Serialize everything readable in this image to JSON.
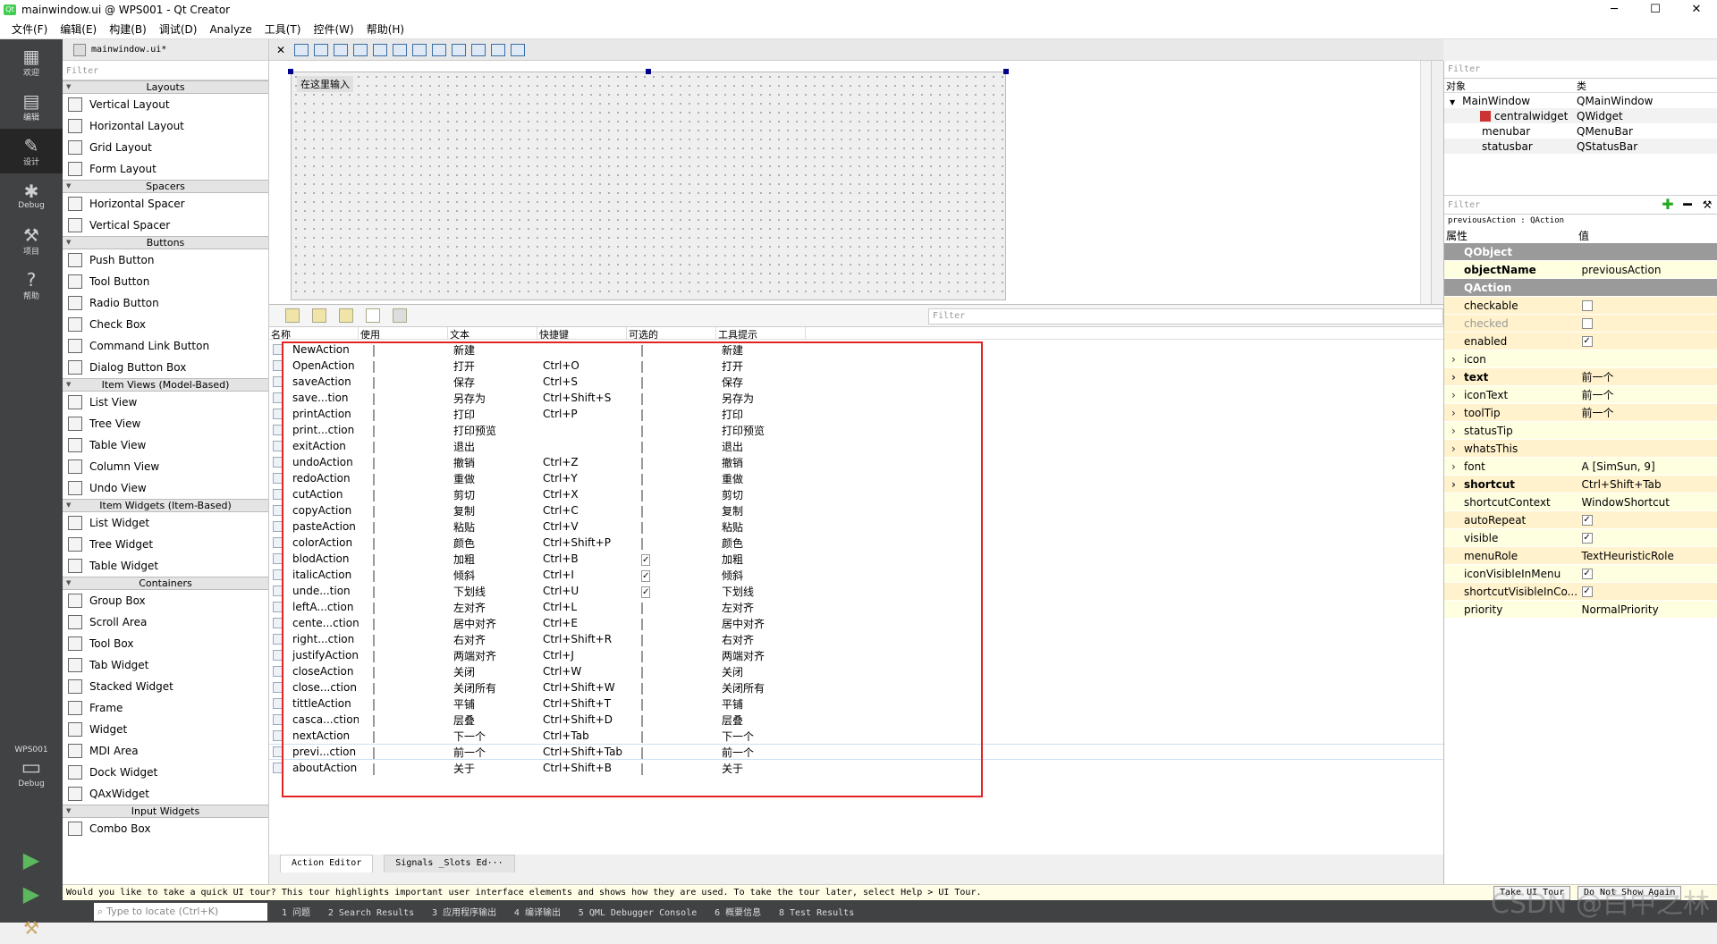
{
  "window": {
    "title": "mainwindow.ui @ WPS001 - Qt Creator",
    "controls": [
      "─",
      "☐",
      "✕"
    ]
  },
  "menus": [
    "文件(F)",
    "编辑(E)",
    "构建(B)",
    "调试(D)",
    "Analyze",
    "工具(T)",
    "控件(W)",
    "帮助(H)"
  ],
  "modes": [
    {
      "label": "欢迎",
      "icon": "grid-icon",
      "glyph": "▦"
    },
    {
      "label": "编辑",
      "icon": "edit-icon",
      "glyph": "▤"
    },
    {
      "label": "设计",
      "icon": "design-icon",
      "glyph": "✎"
    },
    {
      "label": "Debug",
      "icon": "bug-icon",
      "glyph": "✱"
    },
    {
      "label": "项目",
      "icon": "wrench-icon",
      "glyph": "⚒"
    },
    {
      "label": "帮助",
      "icon": "help-icon",
      "glyph": "?"
    }
  ],
  "kit": {
    "name": "WPS001",
    "mode": "Debug"
  },
  "editor": {
    "file_tab": "mainwindow.ui*",
    "form_menu_placeholder": "在这里输入"
  },
  "widget_box": {
    "filter_placeholder": "Filter",
    "sections": [
      {
        "title": "Layouts",
        "items": [
          "Vertical Layout",
          "Horizontal Layout",
          "Grid Layout",
          "Form Layout"
        ]
      },
      {
        "title": "Spacers",
        "items": [
          "Horizontal Spacer",
          "Vertical Spacer"
        ]
      },
      {
        "title": "Buttons",
        "items": [
          "Push Button",
          "Tool Button",
          "Radio Button",
          "Check Box",
          "Command Link Button",
          "Dialog Button Box"
        ]
      },
      {
        "title": "Item Views (Model-Based)",
        "items": [
          "List View",
          "Tree View",
          "Table View",
          "Column View",
          "Undo View"
        ]
      },
      {
        "title": "Item Widgets (Item-Based)",
        "items": [
          "List Widget",
          "Tree Widget",
          "Table Widget"
        ]
      },
      {
        "title": "Containers",
        "items": [
          "Group Box",
          "Scroll Area",
          "Tool Box",
          "Tab Widget",
          "Stacked Widget",
          "Frame",
          "Widget",
          "MDI Area",
          "Dock Widget",
          "QAxWidget"
        ]
      },
      {
        "title": "Input Widgets",
        "items": [
          "Combo Box"
        ]
      }
    ]
  },
  "action_editor": {
    "filter_placeholder": "Filter",
    "columns": [
      "名称",
      "使用",
      "文本",
      "快捷键",
      "可选的",
      "工具提示"
    ],
    "rows": [
      {
        "name": "NewAction",
        "text": "新建",
        "shortcut": "",
        "checkable": false,
        "tooltip": "新建"
      },
      {
        "name": "OpenAction",
        "text": "打开",
        "shortcut": "Ctrl+O",
        "checkable": false,
        "tooltip": "打开"
      },
      {
        "name": "saveAction",
        "text": "保存",
        "shortcut": "Ctrl+S",
        "checkable": false,
        "tooltip": "保存"
      },
      {
        "name": "save...tion",
        "text": "另存为",
        "shortcut": "Ctrl+Shift+S",
        "checkable": false,
        "tooltip": "另存为"
      },
      {
        "name": "printAction",
        "text": "打印",
        "shortcut": "Ctrl+P",
        "checkable": false,
        "tooltip": "打印"
      },
      {
        "name": "print...ction",
        "text": "打印预览",
        "shortcut": "",
        "checkable": false,
        "tooltip": "打印预览"
      },
      {
        "name": "exitAction",
        "text": "退出",
        "shortcut": "",
        "checkable": false,
        "tooltip": "退出"
      },
      {
        "name": "undoAction",
        "text": "撤销",
        "shortcut": "Ctrl+Z",
        "checkable": false,
        "tooltip": "撤销"
      },
      {
        "name": "redoAction",
        "text": "重做",
        "shortcut": "Ctrl+Y",
        "checkable": false,
        "tooltip": "重做"
      },
      {
        "name": "cutAction",
        "text": "剪切",
        "shortcut": "Ctrl+X",
        "checkable": false,
        "tooltip": "剪切"
      },
      {
        "name": "copyAction",
        "text": "复制",
        "shortcut": "Ctrl+C",
        "checkable": false,
        "tooltip": "复制"
      },
      {
        "name": "pasteAction",
        "text": "粘贴",
        "shortcut": "Ctrl+V",
        "checkable": false,
        "tooltip": "粘贴"
      },
      {
        "name": "colorAction",
        "text": "颜色",
        "shortcut": "Ctrl+Shift+P",
        "checkable": false,
        "tooltip": "颜色"
      },
      {
        "name": "blodAction",
        "text": "加粗",
        "shortcut": "Ctrl+B",
        "checkable": true,
        "tooltip": "加粗"
      },
      {
        "name": "italicAction",
        "text": "倾斜",
        "shortcut": "Ctrl+I",
        "checkable": true,
        "tooltip": "倾斜"
      },
      {
        "name": "unde...tion",
        "text": "下划线",
        "shortcut": "Ctrl+U",
        "checkable": true,
        "tooltip": "下划线"
      },
      {
        "name": "leftA...ction",
        "text": "左对齐",
        "shortcut": "Ctrl+L",
        "checkable": false,
        "tooltip": "左对齐"
      },
      {
        "name": "cente...ction",
        "text": "居中对齐",
        "shortcut": "Ctrl+E",
        "checkable": false,
        "tooltip": "居中对齐"
      },
      {
        "name": "right...ction",
        "text": "右对齐",
        "shortcut": "Ctrl+Shift+R",
        "checkable": false,
        "tooltip": "右对齐"
      },
      {
        "name": "justifyAction",
        "text": "两端对齐",
        "shortcut": "Ctrl+J",
        "checkable": false,
        "tooltip": "两端对齐"
      },
      {
        "name": "closeAction",
        "text": "关闭",
        "shortcut": "Ctrl+W",
        "checkable": false,
        "tooltip": "关闭"
      },
      {
        "name": "close...ction",
        "text": "关闭所有",
        "shortcut": "Ctrl+Shift+W",
        "checkable": false,
        "tooltip": "关闭所有"
      },
      {
        "name": "tittleAction",
        "text": "平铺",
        "shortcut": "Ctrl+Shift+T",
        "checkable": false,
        "tooltip": "平铺"
      },
      {
        "name": "casca...ction",
        "text": "层叠",
        "shortcut": "Ctrl+Shift+D",
        "checkable": false,
        "tooltip": "层叠"
      },
      {
        "name": "nextAction",
        "text": "下一个",
        "shortcut": "Ctrl+Tab",
        "checkable": false,
        "tooltip": "下一个"
      },
      {
        "name": "previ...ction",
        "text": "前一个",
        "shortcut": "Ctrl+Shift+Tab",
        "checkable": false,
        "tooltip": "前一个",
        "selected": true
      },
      {
        "name": "aboutAction",
        "text": "关于",
        "shortcut": "Ctrl+Shift+B",
        "checkable": false,
        "tooltip": "关于"
      }
    ],
    "tabs": [
      "Action Editor",
      "Signals _Slots Ed···"
    ]
  },
  "object_inspector": {
    "filter_placeholder": "Filter",
    "columns": [
      "对象",
      "类"
    ],
    "rows": [
      {
        "object": "MainWindow",
        "class": "QMainWindow"
      },
      {
        "object": "centralwidget",
        "class": "QWidget"
      },
      {
        "object": "menubar",
        "class": "QMenuBar"
      },
      {
        "object": "statusbar",
        "class": "QStatusBar"
      }
    ]
  },
  "property_editor": {
    "filter_placeholder": "Filter",
    "context": "previousAction : QAction",
    "columns": [
      "属性",
      "值"
    ],
    "rows": [
      {
        "kind": "sec",
        "name": "QObject",
        "value": ""
      },
      {
        "kind": "b",
        "name": "objectName",
        "value": "previousAction",
        "bg": "y"
      },
      {
        "kind": "sec",
        "name": "QAction",
        "value": ""
      },
      {
        "kind": "cb",
        "name": "checkable",
        "checked": false,
        "bg": "o"
      },
      {
        "kind": "cbdis",
        "name": "checked",
        "checked": false,
        "bg": "o"
      },
      {
        "kind": "cb",
        "name": "enabled",
        "checked": true,
        "bg": "o"
      },
      {
        "kind": "exp",
        "name": "icon",
        "value": "",
        "bg": "y"
      },
      {
        "kind": "expb",
        "name": "text",
        "value": "前一个",
        "bg": "o"
      },
      {
        "kind": "exp",
        "name": "iconText",
        "value": "前一个",
        "bg": "y"
      },
      {
        "kind": "exp",
        "name": "toolTip",
        "value": "前一个",
        "bg": "o"
      },
      {
        "kind": "exp",
        "name": "statusTip",
        "value": "",
        "bg": "y"
      },
      {
        "kind": "exp",
        "name": "whatsThis",
        "value": "",
        "bg": "o"
      },
      {
        "kind": "exp",
        "name": "font",
        "value": "A  [SimSun, 9]",
        "bg": "y"
      },
      {
        "kind": "expb",
        "name": "shortcut",
        "value": "Ctrl+Shift+Tab",
        "bg": "o"
      },
      {
        "kind": "v",
        "name": "shortcutContext",
        "value": "WindowShortcut",
        "bg": "y"
      },
      {
        "kind": "cb",
        "name": "autoRepeat",
        "checked": true,
        "bg": "o"
      },
      {
        "kind": "cb",
        "name": "visible",
        "checked": true,
        "bg": "y"
      },
      {
        "kind": "v",
        "name": "menuRole",
        "value": "TextHeuristicRole",
        "bg": "o"
      },
      {
        "kind": "cb",
        "name": "iconVisibleInMenu",
        "checked": true,
        "bg": "y"
      },
      {
        "kind": "cb",
        "name": "shortcutVisibleInCo...",
        "checked": true,
        "bg": "o"
      },
      {
        "kind": "v",
        "name": "priority",
        "value": "NormalPriority",
        "bg": "y"
      }
    ]
  },
  "tour": {
    "message": "Would you like to take a quick UI tour? This tour highlights important user interface elements and shows how they are used. To take the tour later, select Help > UI Tour.",
    "take_label": "Take UI Tour",
    "dismiss_label": "Do Not Show Again"
  },
  "status": {
    "locator_placeholder": "Type to locate (Ctrl+K)",
    "panes": [
      "1 问题",
      "2 Search Results",
      "3 应用程序输出",
      "4 编译输出",
      "5 QML Debugger Console",
      "6 概要信息",
      "8 Test Results"
    ]
  },
  "watermark": "CSDN @白中之林",
  "colors": {
    "highlight": "#e32222",
    "modebar": "#404244",
    "section": "#9a9a9a"
  }
}
